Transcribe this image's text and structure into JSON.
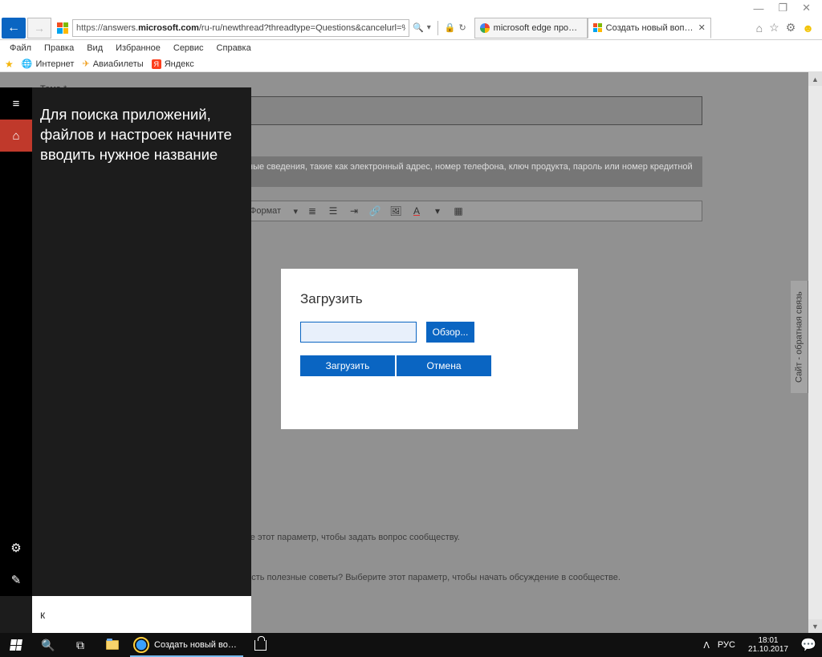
{
  "window_controls": {
    "min": "—",
    "max": "❐",
    "close": "✕"
  },
  "nav": {
    "url_proto": "https://",
    "url_host_pre": "answers.",
    "url_host_bold": "microsoft.com",
    "url_path": "/ru-ru/newthread?threadtype=Questions&cancelurl=%2F",
    "search_glyph": "🔍",
    "lock_glyph": "🔒",
    "refresh_glyph": "↻"
  },
  "tabs": [
    {
      "label": "microsoft edge пропал - Пои…"
    },
    {
      "label": "Создать новый вопрос ил…"
    }
  ],
  "right_icons": {
    "home": "⌂",
    "star": "☆",
    "gear": "⚙",
    "smiley": "☻"
  },
  "menu": [
    "Файл",
    "Правка",
    "Вид",
    "Избранное",
    "Сервис",
    "Справка"
  ],
  "bookmarks": [
    {
      "label": "Интернет"
    },
    {
      "label": "Авиабилеты"
    },
    {
      "label": "Яндекс"
    }
  ],
  "page": {
    "topic_label": "Тема *",
    "privacy": "В целях конфиденциальности не публикуйте личные сведения, такие как электронный адрес, номер телефона, ключ продукта, пароль или номер кредитной карты.",
    "format_label": "Формат",
    "help1": "Возникла проблема и требуется помощь? Выберите этот параметр, чтобы задать вопрос сообществу.",
    "help2": "Хотите поделиться с нами своим мнением? У вас есть полезные советы? Выберите этот параметр, чтобы начать обсуждение в сообществе.",
    "feedback": "Сайт - обратная связь"
  },
  "search_panel": {
    "message": "Для поиска приложений, файлов и настроек начните вводить нужное название",
    "input_value": "к"
  },
  "modal": {
    "title": "Загрузить",
    "browse": "Обзор...",
    "upload": "Загрузить",
    "cancel": "Отмена"
  },
  "taskbar": {
    "app_label": "Создать новый во…",
    "lang": "РУС",
    "time": "18:01",
    "date": "21.10.2017",
    "tray_up": "ᐱ"
  }
}
